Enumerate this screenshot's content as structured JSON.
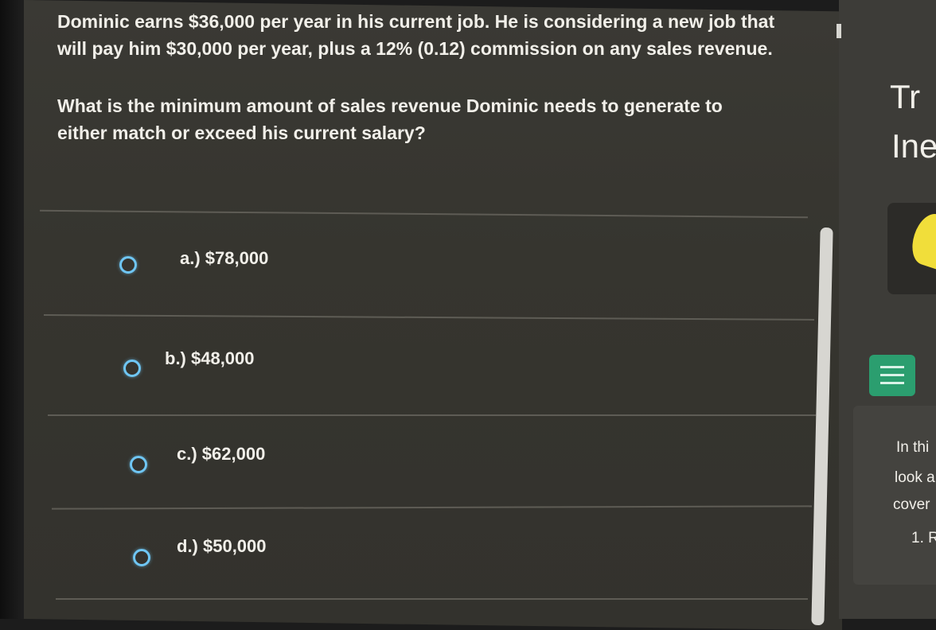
{
  "question": {
    "line1": "Dominic earns $36,000 per year in his current job. He is considering a new job that",
    "line2": "will pay him $30,000 per year, plus a 12% (0.12) commission on any sales revenue.",
    "line3": "What is the minimum amount of sales revenue Dominic needs to generate to",
    "line4": "either match or exceed his current salary?"
  },
  "options": [
    {
      "label": "a.) $78,000"
    },
    {
      "label": "b.) $48,000"
    },
    {
      "label": "c.) $62,000"
    },
    {
      "label": "d.) $50,000"
    }
  ],
  "right_panel": {
    "title_partial_1": "Tr",
    "title_partial_2": "Ine",
    "text_1": "In thi",
    "text_2": "look a",
    "text_3": "cover",
    "text_4": "1. R",
    "list_icon": "list-icon"
  },
  "colors": {
    "radio_accent": "#6fc6f4",
    "list_button": "#2b9e6f",
    "yellow_accent": "#f1de3a"
  }
}
